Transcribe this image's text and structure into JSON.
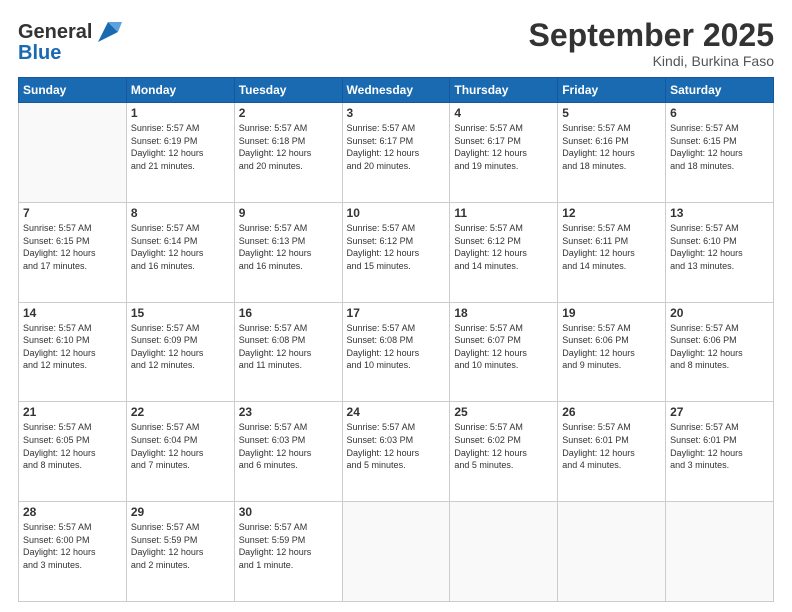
{
  "header": {
    "logo_line1": "General",
    "logo_line2": "Blue",
    "month_title": "September 2025",
    "location": "Kindi, Burkina Faso"
  },
  "days_of_week": [
    "Sunday",
    "Monday",
    "Tuesday",
    "Wednesday",
    "Thursday",
    "Friday",
    "Saturday"
  ],
  "weeks": [
    [
      {
        "day": "",
        "info": ""
      },
      {
        "day": "1",
        "info": "Sunrise: 5:57 AM\nSunset: 6:19 PM\nDaylight: 12 hours\nand 21 minutes."
      },
      {
        "day": "2",
        "info": "Sunrise: 5:57 AM\nSunset: 6:18 PM\nDaylight: 12 hours\nand 20 minutes."
      },
      {
        "day": "3",
        "info": "Sunrise: 5:57 AM\nSunset: 6:17 PM\nDaylight: 12 hours\nand 20 minutes."
      },
      {
        "day": "4",
        "info": "Sunrise: 5:57 AM\nSunset: 6:17 PM\nDaylight: 12 hours\nand 19 minutes."
      },
      {
        "day": "5",
        "info": "Sunrise: 5:57 AM\nSunset: 6:16 PM\nDaylight: 12 hours\nand 18 minutes."
      },
      {
        "day": "6",
        "info": "Sunrise: 5:57 AM\nSunset: 6:15 PM\nDaylight: 12 hours\nand 18 minutes."
      }
    ],
    [
      {
        "day": "7",
        "info": "Sunrise: 5:57 AM\nSunset: 6:15 PM\nDaylight: 12 hours\nand 17 minutes."
      },
      {
        "day": "8",
        "info": "Sunrise: 5:57 AM\nSunset: 6:14 PM\nDaylight: 12 hours\nand 16 minutes."
      },
      {
        "day": "9",
        "info": "Sunrise: 5:57 AM\nSunset: 6:13 PM\nDaylight: 12 hours\nand 16 minutes."
      },
      {
        "day": "10",
        "info": "Sunrise: 5:57 AM\nSunset: 6:12 PM\nDaylight: 12 hours\nand 15 minutes."
      },
      {
        "day": "11",
        "info": "Sunrise: 5:57 AM\nSunset: 6:12 PM\nDaylight: 12 hours\nand 14 minutes."
      },
      {
        "day": "12",
        "info": "Sunrise: 5:57 AM\nSunset: 6:11 PM\nDaylight: 12 hours\nand 14 minutes."
      },
      {
        "day": "13",
        "info": "Sunrise: 5:57 AM\nSunset: 6:10 PM\nDaylight: 12 hours\nand 13 minutes."
      }
    ],
    [
      {
        "day": "14",
        "info": "Sunrise: 5:57 AM\nSunset: 6:10 PM\nDaylight: 12 hours\nand 12 minutes."
      },
      {
        "day": "15",
        "info": "Sunrise: 5:57 AM\nSunset: 6:09 PM\nDaylight: 12 hours\nand 12 minutes."
      },
      {
        "day": "16",
        "info": "Sunrise: 5:57 AM\nSunset: 6:08 PM\nDaylight: 12 hours\nand 11 minutes."
      },
      {
        "day": "17",
        "info": "Sunrise: 5:57 AM\nSunset: 6:08 PM\nDaylight: 12 hours\nand 10 minutes."
      },
      {
        "day": "18",
        "info": "Sunrise: 5:57 AM\nSunset: 6:07 PM\nDaylight: 12 hours\nand 10 minutes."
      },
      {
        "day": "19",
        "info": "Sunrise: 5:57 AM\nSunset: 6:06 PM\nDaylight: 12 hours\nand 9 minutes."
      },
      {
        "day": "20",
        "info": "Sunrise: 5:57 AM\nSunset: 6:06 PM\nDaylight: 12 hours\nand 8 minutes."
      }
    ],
    [
      {
        "day": "21",
        "info": "Sunrise: 5:57 AM\nSunset: 6:05 PM\nDaylight: 12 hours\nand 8 minutes."
      },
      {
        "day": "22",
        "info": "Sunrise: 5:57 AM\nSunset: 6:04 PM\nDaylight: 12 hours\nand 7 minutes."
      },
      {
        "day": "23",
        "info": "Sunrise: 5:57 AM\nSunset: 6:03 PM\nDaylight: 12 hours\nand 6 minutes."
      },
      {
        "day": "24",
        "info": "Sunrise: 5:57 AM\nSunset: 6:03 PM\nDaylight: 12 hours\nand 5 minutes."
      },
      {
        "day": "25",
        "info": "Sunrise: 5:57 AM\nSunset: 6:02 PM\nDaylight: 12 hours\nand 5 minutes."
      },
      {
        "day": "26",
        "info": "Sunrise: 5:57 AM\nSunset: 6:01 PM\nDaylight: 12 hours\nand 4 minutes."
      },
      {
        "day": "27",
        "info": "Sunrise: 5:57 AM\nSunset: 6:01 PM\nDaylight: 12 hours\nand 3 minutes."
      }
    ],
    [
      {
        "day": "28",
        "info": "Sunrise: 5:57 AM\nSunset: 6:00 PM\nDaylight: 12 hours\nand 3 minutes."
      },
      {
        "day": "29",
        "info": "Sunrise: 5:57 AM\nSunset: 5:59 PM\nDaylight: 12 hours\nand 2 minutes."
      },
      {
        "day": "30",
        "info": "Sunrise: 5:57 AM\nSunset: 5:59 PM\nDaylight: 12 hours\nand 1 minute."
      },
      {
        "day": "",
        "info": ""
      },
      {
        "day": "",
        "info": ""
      },
      {
        "day": "",
        "info": ""
      },
      {
        "day": "",
        "info": ""
      }
    ]
  ]
}
